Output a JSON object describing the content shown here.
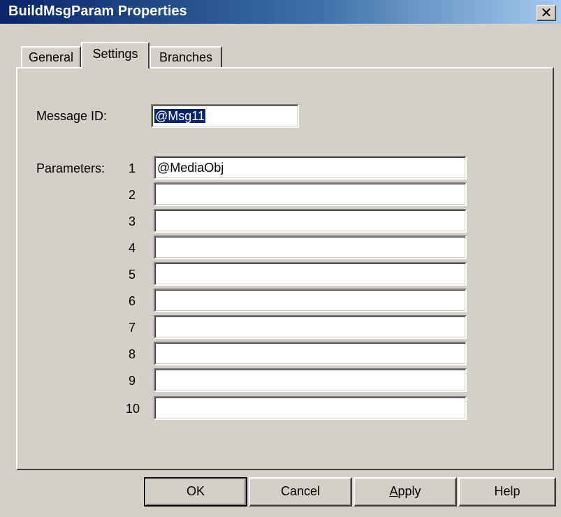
{
  "window": {
    "title": "BuildMsgParam Properties",
    "close_glyph": "✕"
  },
  "tabs": [
    {
      "label": "General",
      "active": false
    },
    {
      "label": "Settings",
      "active": true
    },
    {
      "label": "Branches",
      "active": false
    }
  ],
  "settings": {
    "message_id_label": "Message ID:",
    "message_id_value": "@Msg11",
    "parameters_label": "Parameters:",
    "parameters": [
      {
        "index": "1",
        "value": "@MediaObj"
      },
      {
        "index": "2",
        "value": ""
      },
      {
        "index": "3",
        "value": ""
      },
      {
        "index": "4",
        "value": ""
      },
      {
        "index": "5",
        "value": ""
      },
      {
        "index": "6",
        "value": ""
      },
      {
        "index": "7",
        "value": ""
      },
      {
        "index": "8",
        "value": ""
      },
      {
        "index": "9",
        "value": ""
      },
      {
        "index": "10",
        "value": ""
      }
    ]
  },
  "buttons": {
    "ok": "OK",
    "cancel": "Cancel",
    "apply_first": "A",
    "apply_rest": "pply",
    "help": "Help"
  }
}
